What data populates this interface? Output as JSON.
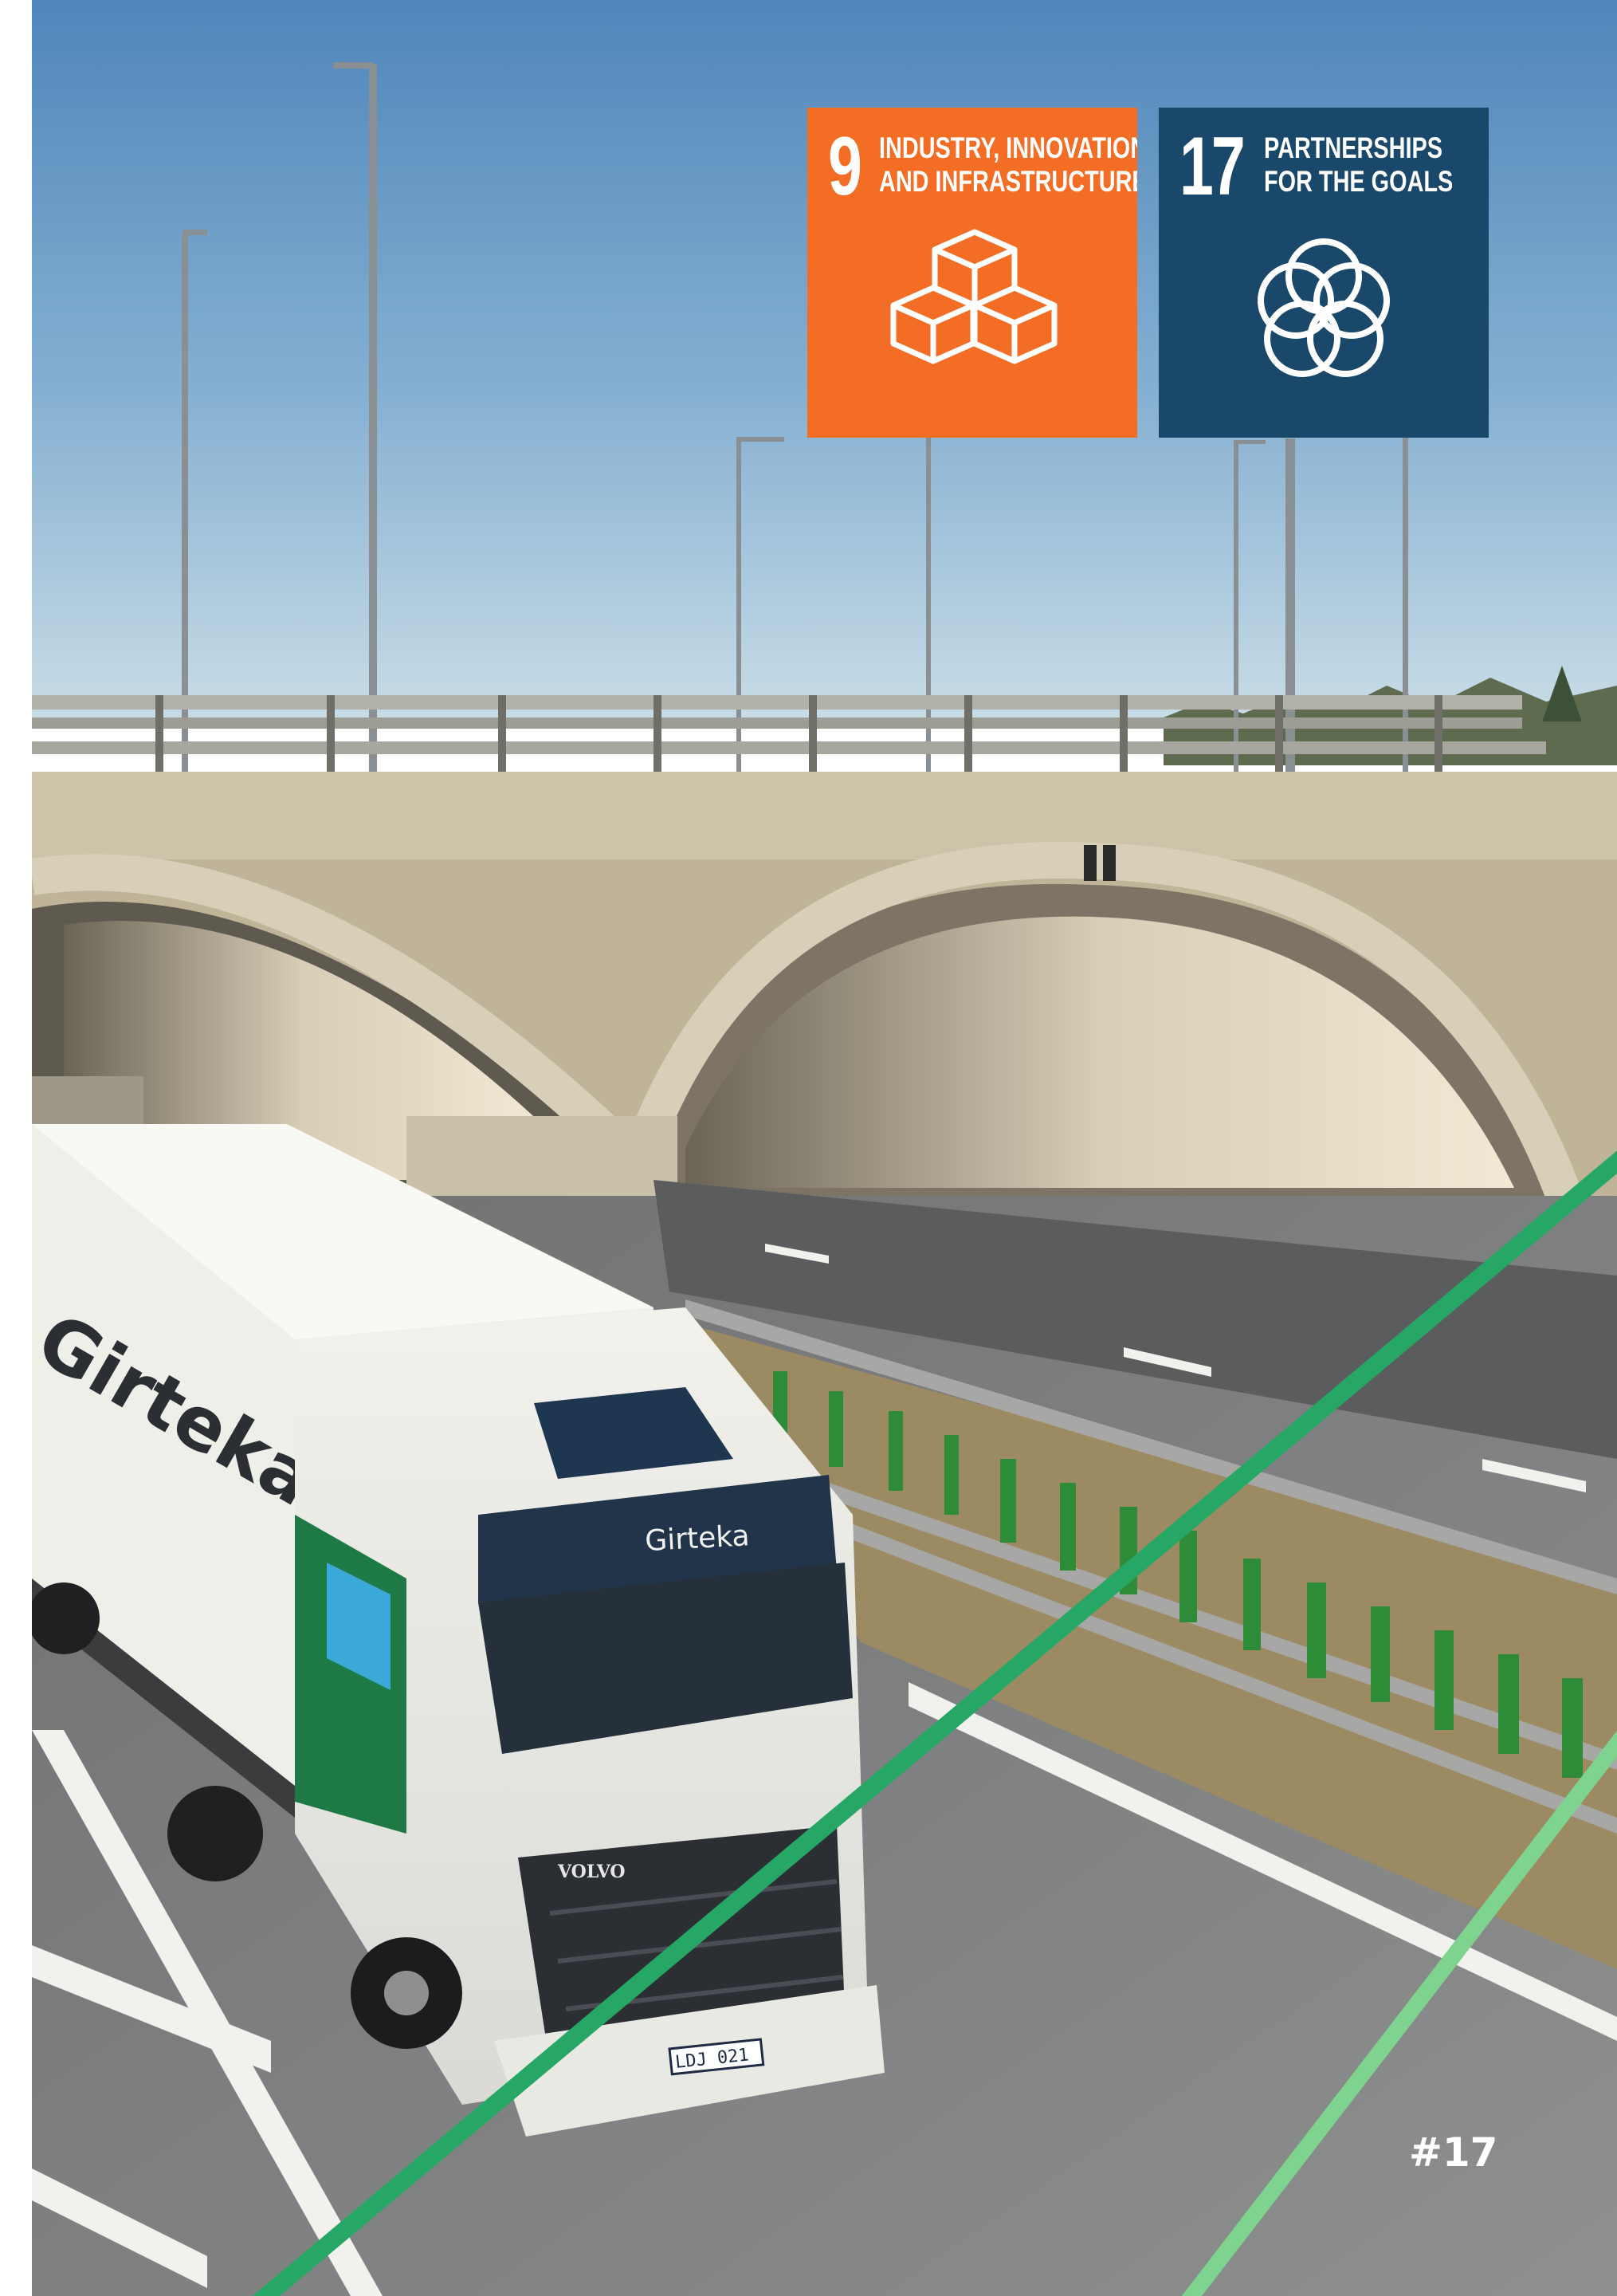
{
  "sdg_badges": [
    {
      "number": "9",
      "title_line1": "INDUSTRY, INNOVATION",
      "title_line2": "AND INFRASTRUCTURE",
      "color": "#F36D25",
      "icon": "stacked-cubes-icon"
    },
    {
      "number": "17",
      "title_line1": "PARTNERSHIPS",
      "title_line2": "FOR THE GOALS",
      "color": "#19486A",
      "icon": "interlocking-rings-icon"
    }
  ],
  "photo": {
    "truck_brand": "Girteka",
    "trailer_brand": "Girteka",
    "license_plate": "LDJ 021",
    "cab_make": "VOLVO",
    "accent_line_colors": [
      "#27A765",
      "#7ED48E"
    ]
  },
  "page_number": "#17"
}
